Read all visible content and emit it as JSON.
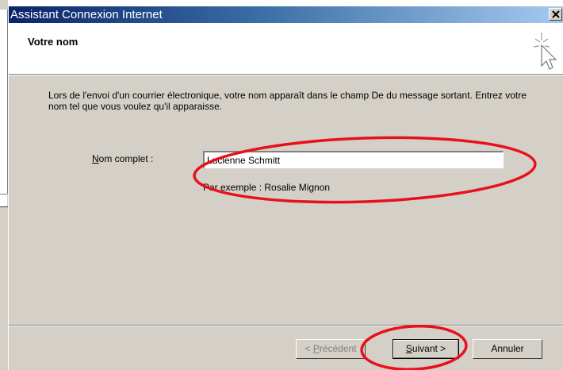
{
  "window": {
    "title": "Assistant Connexion Internet"
  },
  "header": {
    "title": "Votre nom",
    "icon": "wizard-sparkle-cursor-icon"
  },
  "main": {
    "intro": "Lors de l'envoi d'un courrier électronique, votre nom apparaît dans le champ De du message sortant. Entrez votre nom tel que vous voulez qu'il apparaisse.",
    "name_label_accel": "N",
    "name_label_rest": "om complet :",
    "name_value": "Lucienne Schmitt",
    "example": "Par exemple : Rosalie Mignon"
  },
  "footer": {
    "prev_label_accel": "P",
    "prev_label_prefix": "< ",
    "prev_label_rest": "récédent",
    "next_label_accel": "S",
    "next_label_rest": "uivant >",
    "cancel_label": "Annuler"
  },
  "colors": {
    "annotation": "#e8101a",
    "titlebar_start": "#0a246a",
    "titlebar_end": "#a6caf0"
  }
}
